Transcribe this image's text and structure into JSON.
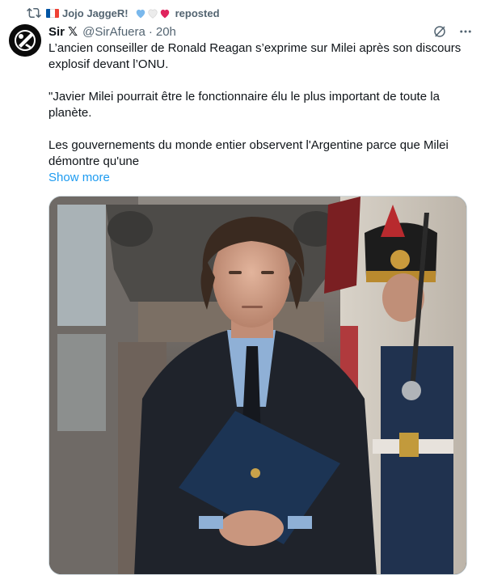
{
  "repost": {
    "user_name": "Jojo JaggeR!",
    "label": "reposted",
    "flag_colors": [
      "#0055A4",
      "#FFFFFF",
      "#EF4135"
    ],
    "heart_colors": [
      "#7ab8ec",
      "#e8e8e8",
      "#e0245e"
    ]
  },
  "author": {
    "display_name": "Sir",
    "badge": "𝕏",
    "handle": "@SirAfuera",
    "separator": "·",
    "time": "20h"
  },
  "tweet": {
    "paragraphs": [
      "L’ancien conseiller de Ronald Reagan s’exprime sur Milei après son discours explosif devant l’ONU.",
      "\"Javier Milei pourrait être le fonctionnaire élu le plus important de toute la planète.",
      "Les gouvernements du monde entier observent l'Argentine parce que Milei démontre qu'une"
    ],
    "show_more": "Show more"
  },
  "colors": {
    "text": "#0f1419",
    "secondary": "#536471",
    "link": "#1d9bf0",
    "border": "#cfd9de"
  },
  "icons": {
    "repost": "repost-icon",
    "grok": "grok-icon",
    "more": "more-icon"
  }
}
